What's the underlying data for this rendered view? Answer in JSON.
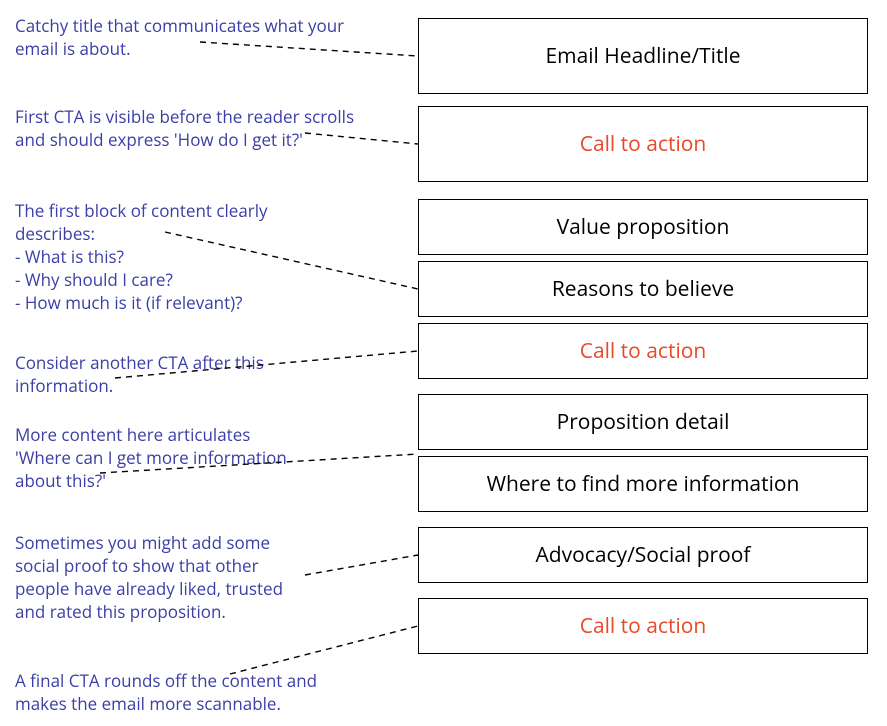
{
  "annotations": {
    "a1": "Catchy title that communicates what your\nemail is about.",
    "a2": "First CTA is visible before the reader scrolls\nand should express 'How do I get it?'",
    "a3": "The first block of content clearly\ndescribes:\n- What is this?\n- Why should I care?\n- How much is it (if relevant)?",
    "a4": "Consider another CTA after this\ninformation.",
    "a5": "More content here articulates\n'Where can I get more information\nabout this?'",
    "a6": "Sometimes you might add some\nsocial proof to show that other\npeople have already liked, trusted\nand rated this proposition.",
    "a7": "A final CTA rounds off the content and\nmakes the email more scannable."
  },
  "boxes": {
    "b1": "Email Headline/Title",
    "b2": "Call to action",
    "b3": "Value proposition",
    "b4": "Reasons to believe",
    "b5": "Call to action",
    "b6": "Proposition detail",
    "b7": "Where to find more information",
    "b8": "Advocacy/Social proof",
    "b9": "Call to action"
  }
}
